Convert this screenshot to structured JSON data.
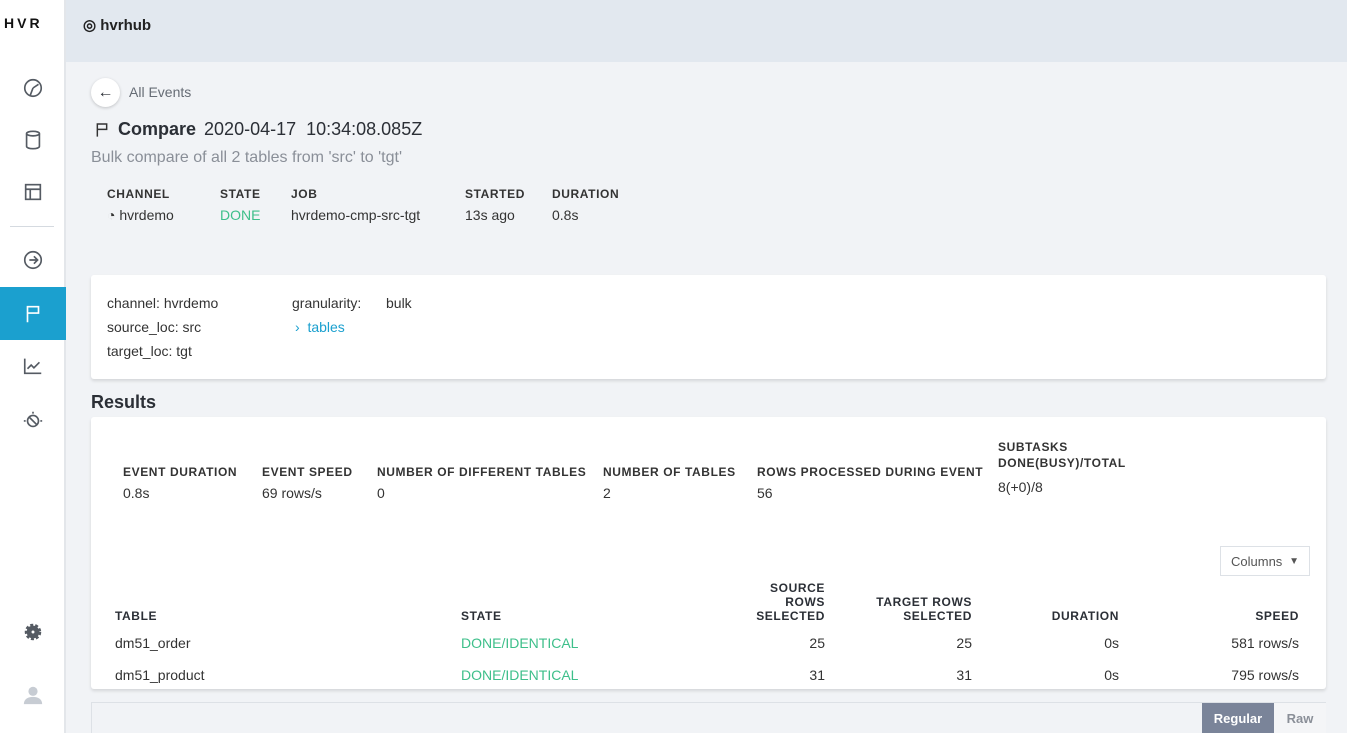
{
  "app": {
    "logo": "HVR",
    "hub": "◎ hvrhub"
  },
  "sidebar": {
    "items": [
      {
        "icon": "dashboard-icon"
      },
      {
        "icon": "database-icon"
      },
      {
        "icon": "table-icon"
      },
      {
        "icon": "arrow-right-circle-icon"
      },
      {
        "icon": "flag-icon",
        "active": true
      },
      {
        "icon": "chart-icon"
      },
      {
        "icon": "satellite-icon"
      },
      {
        "icon": "gear-icon"
      },
      {
        "icon": "user-icon"
      }
    ]
  },
  "breadcrumb": {
    "back_label": "All Events"
  },
  "event": {
    "type": "Compare",
    "timestamp": "2020-04-17  10:34:08.085Z",
    "description": "Bulk compare of all 2 tables from 'src' to 'tgt'"
  },
  "meta": [
    {
      "label": "CHANNEL",
      "value": "hvrdemo"
    },
    {
      "label": "STATE",
      "value": "DONE"
    },
    {
      "label": "JOB",
      "value": "hvrdemo-cmp-src-tgt"
    },
    {
      "label": "STARTED",
      "value": "13s ago"
    },
    {
      "label": "DURATION",
      "value": "0.8s"
    }
  ],
  "params": {
    "channel": "channel: hvrdemo",
    "source_loc": "source_loc: src",
    "target_loc": "target_loc: tgt",
    "granularity_label": "granularity:",
    "granularity_value": "bulk",
    "tables_link": "tables"
  },
  "results": {
    "title": "Results",
    "stats": [
      {
        "label": "EVENT DURATION",
        "value": "0.8s"
      },
      {
        "label": "EVENT SPEED",
        "value": "69 rows/s"
      },
      {
        "label": "NUMBER OF DIFFERENT TABLES",
        "value": "0"
      },
      {
        "label": "NUMBER OF TABLES",
        "value": "2"
      },
      {
        "label": "ROWS PROCESSED DURING EVENT",
        "value": "56"
      },
      {
        "label": "SUBTASKS DONE(BUSY)/TOTAL",
        "value": "8(+0)/8"
      }
    ],
    "columns_button": "Columns",
    "headers": [
      "TABLE",
      "STATE",
      "SOURCE ROWS SELECTED",
      "TARGET ROWS SELECTED",
      "DURATION",
      "SPEED"
    ],
    "rows": [
      [
        "dm51_order",
        "DONE/IDENTICAL",
        "25",
        "25",
        "0s",
        "581 rows/s"
      ],
      [
        "dm51_product",
        "DONE/IDENTICAL",
        "31",
        "31",
        "0s",
        "795 rows/s"
      ]
    ]
  },
  "view_toggle": {
    "regular": "Regular",
    "raw": "Raw"
  },
  "colors": {
    "accent": "#1ba0cf",
    "success": "#3dbf8a"
  }
}
